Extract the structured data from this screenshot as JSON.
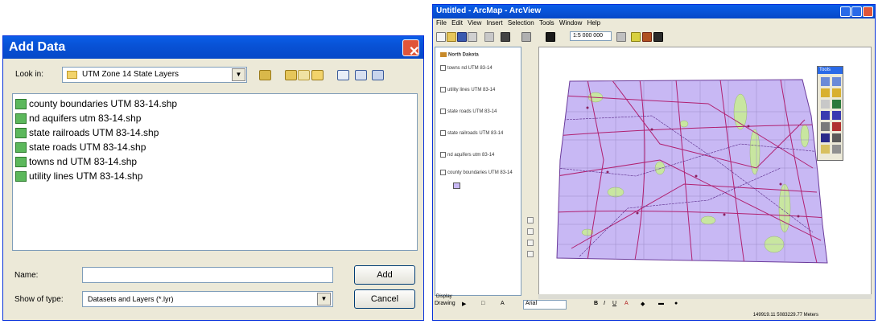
{
  "add_data": {
    "title": "Add Data",
    "look_in_label": "Look in:",
    "look_in_value": "UTM Zone 14 State Layers",
    "files": [
      "county boundaries UTM 83-14.shp",
      "nd aquifers utm 83-14.shp",
      "state railroads UTM 83-14.shp",
      "state roads UTM 83-14.shp",
      "towns nd UTM 83-14.shp",
      "utility lines UTM 83-14.shp"
    ],
    "name_label": "Name:",
    "name_value": "",
    "type_label": "Show of type:",
    "type_value": "Datasets and Layers (*.lyr)",
    "add_button": "Add",
    "cancel_button": "Cancel"
  },
  "arcmap": {
    "title": "Untitled - ArcMap - ArcView",
    "menus": [
      "File",
      "Edit",
      "View",
      "Insert",
      "Selection",
      "Tools",
      "Window",
      "Help"
    ],
    "scale": "1:5 000 000",
    "toc_items": [
      "North Dakota",
      "towns nd UTM 83-14",
      "utility lines UTM 83-14",
      "state roads UTM 83-14",
      "state railroads UTM 83-14",
      "nd aquifers utm 83-14",
      "county boundaries UTM 83-14"
    ],
    "tools_title": "Tools",
    "drawing_label": "Drawing",
    "font_value": "Arial",
    "status_text": "149919.11 5083229.77 Meters",
    "toc_bottom_tab": "Display",
    "colors": {
      "map_fill": "#c8b8f4",
      "roads": "#b02070",
      "aquifers": "#c8e6a0",
      "title_bar": "#0648c8"
    }
  }
}
